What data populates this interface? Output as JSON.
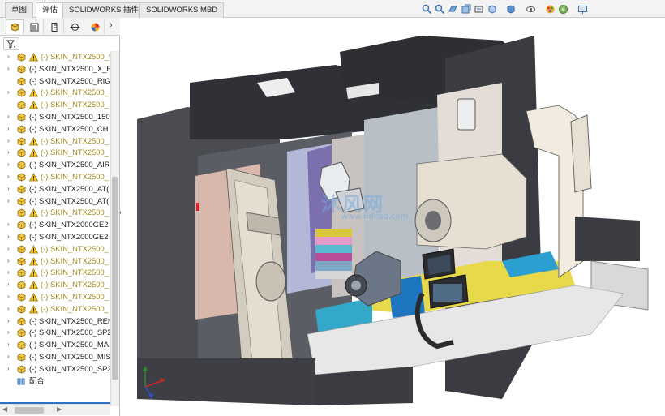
{
  "tabs": [
    {
      "label": "草图",
      "active": false
    },
    {
      "label": "评估",
      "active": true
    },
    {
      "label": "SOLIDWORKS 插件",
      "active": false
    },
    {
      "label": "SOLIDWORKS MBD",
      "active": false
    }
  ],
  "view_toolbar_icons": [
    "zoom-to-fit-icon",
    "zoom-area-icon",
    "previous-view-icon",
    "section-view-icon",
    "dynamic-annotation-icon",
    "view-orientation-icon",
    "display-style-icon",
    "hide-show-icon",
    "edit-appearance-icon",
    "apply-scene-icon",
    "view-settings-icon"
  ],
  "panel_tabs": [
    "feature-manager-icon",
    "property-manager-icon",
    "configuration-manager-icon",
    "dimxpert-icon",
    "display-manager-icon"
  ],
  "tree": [
    {
      "label": "(-) SKIN_NTX2500_^",
      "warn": true,
      "expand": true
    },
    {
      "label": "(-) SKIN_NTX2500_X_F",
      "warn": false,
      "expand": true
    },
    {
      "label": "(-) SKIN_NTX2500_RIG",
      "warn": false,
      "expand": false
    },
    {
      "label": "(-) SKIN_NTX2500_",
      "warn": true,
      "expand": true
    },
    {
      "label": "(-) SKIN_NTX2500_",
      "warn": true,
      "expand": false
    },
    {
      "label": "(-) SKIN_NTX2500_150",
      "warn": false,
      "expand": true
    },
    {
      "label": "(-) SKIN_NTX2500_CH",
      "warn": false,
      "expand": true
    },
    {
      "label": "(-) SKIN_NTX2500_",
      "warn": true,
      "expand": true
    },
    {
      "label": "(-) SKIN_NTX2500_",
      "warn": true,
      "expand": true
    },
    {
      "label": "(-) SKIN_NTX2500_AIR",
      "warn": false,
      "expand": true
    },
    {
      "label": "(-) SKIN_NTX2500_",
      "warn": true,
      "expand": true
    },
    {
      "label": "(-) SKIN_NTX2500_AT(",
      "warn": false,
      "expand": true
    },
    {
      "label": "(-) SKIN_NTX2500_AT(",
      "warn": false,
      "expand": true
    },
    {
      "label": "(-) SKIN_NTX2500_",
      "warn": true,
      "expand": false
    },
    {
      "label": "(-) SKIN_NTX2000GE2",
      "warn": false,
      "expand": true
    },
    {
      "label": "(-) SKIN_NTX2000GE2",
      "warn": false,
      "expand": true
    },
    {
      "label": "(-) SKIN_NTX2500_",
      "warn": true,
      "expand": true
    },
    {
      "label": "(-) SKIN_NTX2500_",
      "warn": true,
      "expand": true
    },
    {
      "label": "(-) SKIN_NTX2500_",
      "warn": true,
      "expand": true
    },
    {
      "label": "(-) SKIN_NTX2500_",
      "warn": true,
      "expand": true
    },
    {
      "label": "(-) SKIN_NTX2500_",
      "warn": true,
      "expand": true
    },
    {
      "label": "(-) SKIN_NTX2500_",
      "warn": true,
      "expand": true
    },
    {
      "label": "(-) SKIN_NTX2500_REN",
      "warn": false,
      "expand": true
    },
    {
      "label": "(-) SKIN_NTX2500_SP2",
      "warn": false,
      "expand": true
    },
    {
      "label": "(-) SKIN_NTX2500_MA",
      "warn": false,
      "expand": true
    },
    {
      "label": "(-) SKIN_NTX2500_MIS",
      "warn": false,
      "expand": true
    },
    {
      "label": "(-) SKIN_NTX2500_SP2",
      "warn": false,
      "expand": true
    }
  ],
  "mates_label": "配合",
  "watermark": {
    "main": "沐风网",
    "url": "www.mfcad.com"
  },
  "colors": {
    "tab_active": "#ffffff",
    "warn_text": "#a08a1c",
    "selection_line": "#2f6fc4"
  }
}
